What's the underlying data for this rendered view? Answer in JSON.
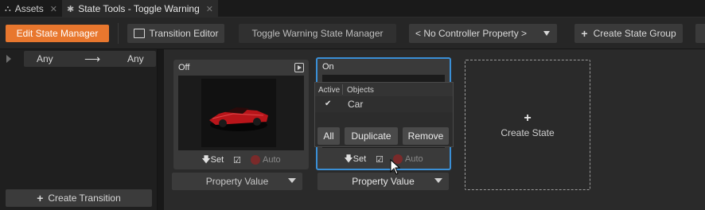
{
  "tabs": [
    {
      "label": "Assets",
      "icon": "assets-icon"
    },
    {
      "label": "State Tools - Toggle Warning",
      "icon": "state-tools-icon"
    }
  ],
  "toolbar": {
    "edit_state_manager": "Edit State Manager",
    "transition_editor": "Transition Editor",
    "state_manager_name": "Toggle Warning State Manager",
    "controller_property": "< No Controller Property >",
    "create_state_group": "Create State Group"
  },
  "transition": {
    "from": "Any",
    "to": "Any",
    "create_label": "Create Transition"
  },
  "states": [
    {
      "name": "Off",
      "set_label": "Set",
      "auto_label": "Auto",
      "dropdown": "Property Value"
    },
    {
      "name": "On",
      "set_label": "Set",
      "auto_label": "Auto",
      "dropdown": "Property Value"
    }
  ],
  "popup": {
    "col_active": "Active",
    "col_objects": "Objects",
    "rows": [
      {
        "active": "✔",
        "object": "Car"
      }
    ],
    "buttons": {
      "all": "All",
      "duplicate": "Duplicate",
      "remove": "Remove"
    }
  },
  "create_state": {
    "icon": "+",
    "label": "Create State"
  },
  "colors": {
    "accent": "#e8772e",
    "selection": "#3a8fd6"
  }
}
